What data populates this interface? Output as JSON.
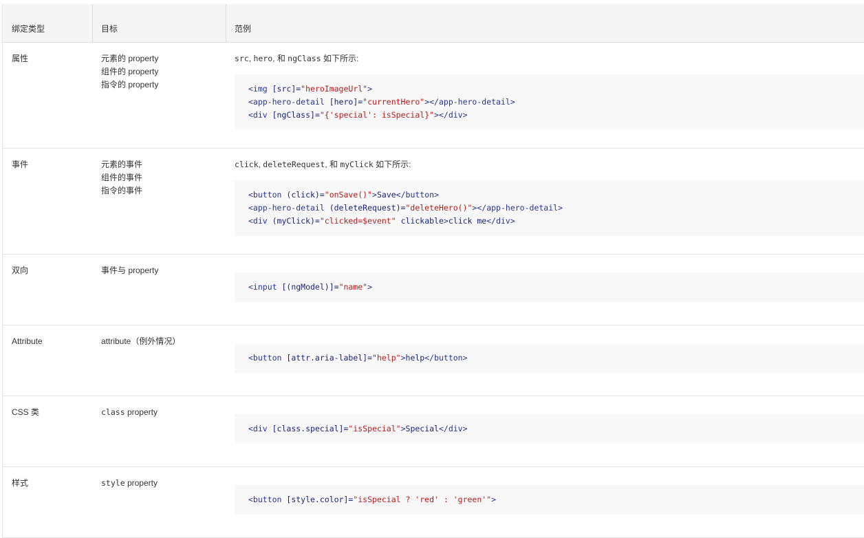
{
  "header": {
    "col1": "绑定类型",
    "col2": "目标",
    "col3": "范例"
  },
  "rows": [
    {
      "type": "属性",
      "targets": [
        "元素的 property",
        "组件的 property",
        "指令的 property"
      ],
      "intro": {
        "c1": "src",
        "s1": ", ",
        "c2": "hero",
        "s2": ", 和 ",
        "c3": "ngClass",
        "s3": " 如下所示:"
      },
      "code": [
        "<img [src]=\"heroImageUrl\">",
        "<app-hero-detail [hero]=\"currentHero\"></app-hero-detail>",
        "<div [ngClass]=\"{'special': isSpecial}\"></div>"
      ]
    },
    {
      "type": "事件",
      "targets": [
        "元素的事件",
        "组件的事件",
        "指令的事件"
      ],
      "intro": {
        "c1": "click",
        "s1": ", ",
        "c2": "deleteRequest",
        "s2": ", 和 ",
        "c3": "myClick",
        "s3": " 如下所示:"
      },
      "code": [
        "<button (click)=\"onSave()\">Save</button>",
        "<app-hero-detail (deleteRequest)=\"deleteHero()\"></app-hero-detail>",
        "<div (myClick)=\"clicked=$event\" clickable>click me</div>"
      ]
    },
    {
      "type": "双向",
      "targets": [
        "事件与 property"
      ],
      "code": [
        "<input [(ngModel)]=\"name\">"
      ]
    },
    {
      "type": "Attribute",
      "targets": [
        "attribute（例外情况）"
      ],
      "code": [
        "<button [attr.aria-label]=\"help\">help</button>"
      ]
    },
    {
      "type": "CSS 类",
      "target_mono": "class",
      "target_rest": " property",
      "code": [
        "<div [class.special]=\"isSpecial\">Special</div>"
      ]
    },
    {
      "type": "样式",
      "target_mono": "style",
      "target_rest": " property",
      "code": [
        "<button [style.color]=\"isSpecial ? 'red' : 'green'\">"
      ]
    }
  ]
}
